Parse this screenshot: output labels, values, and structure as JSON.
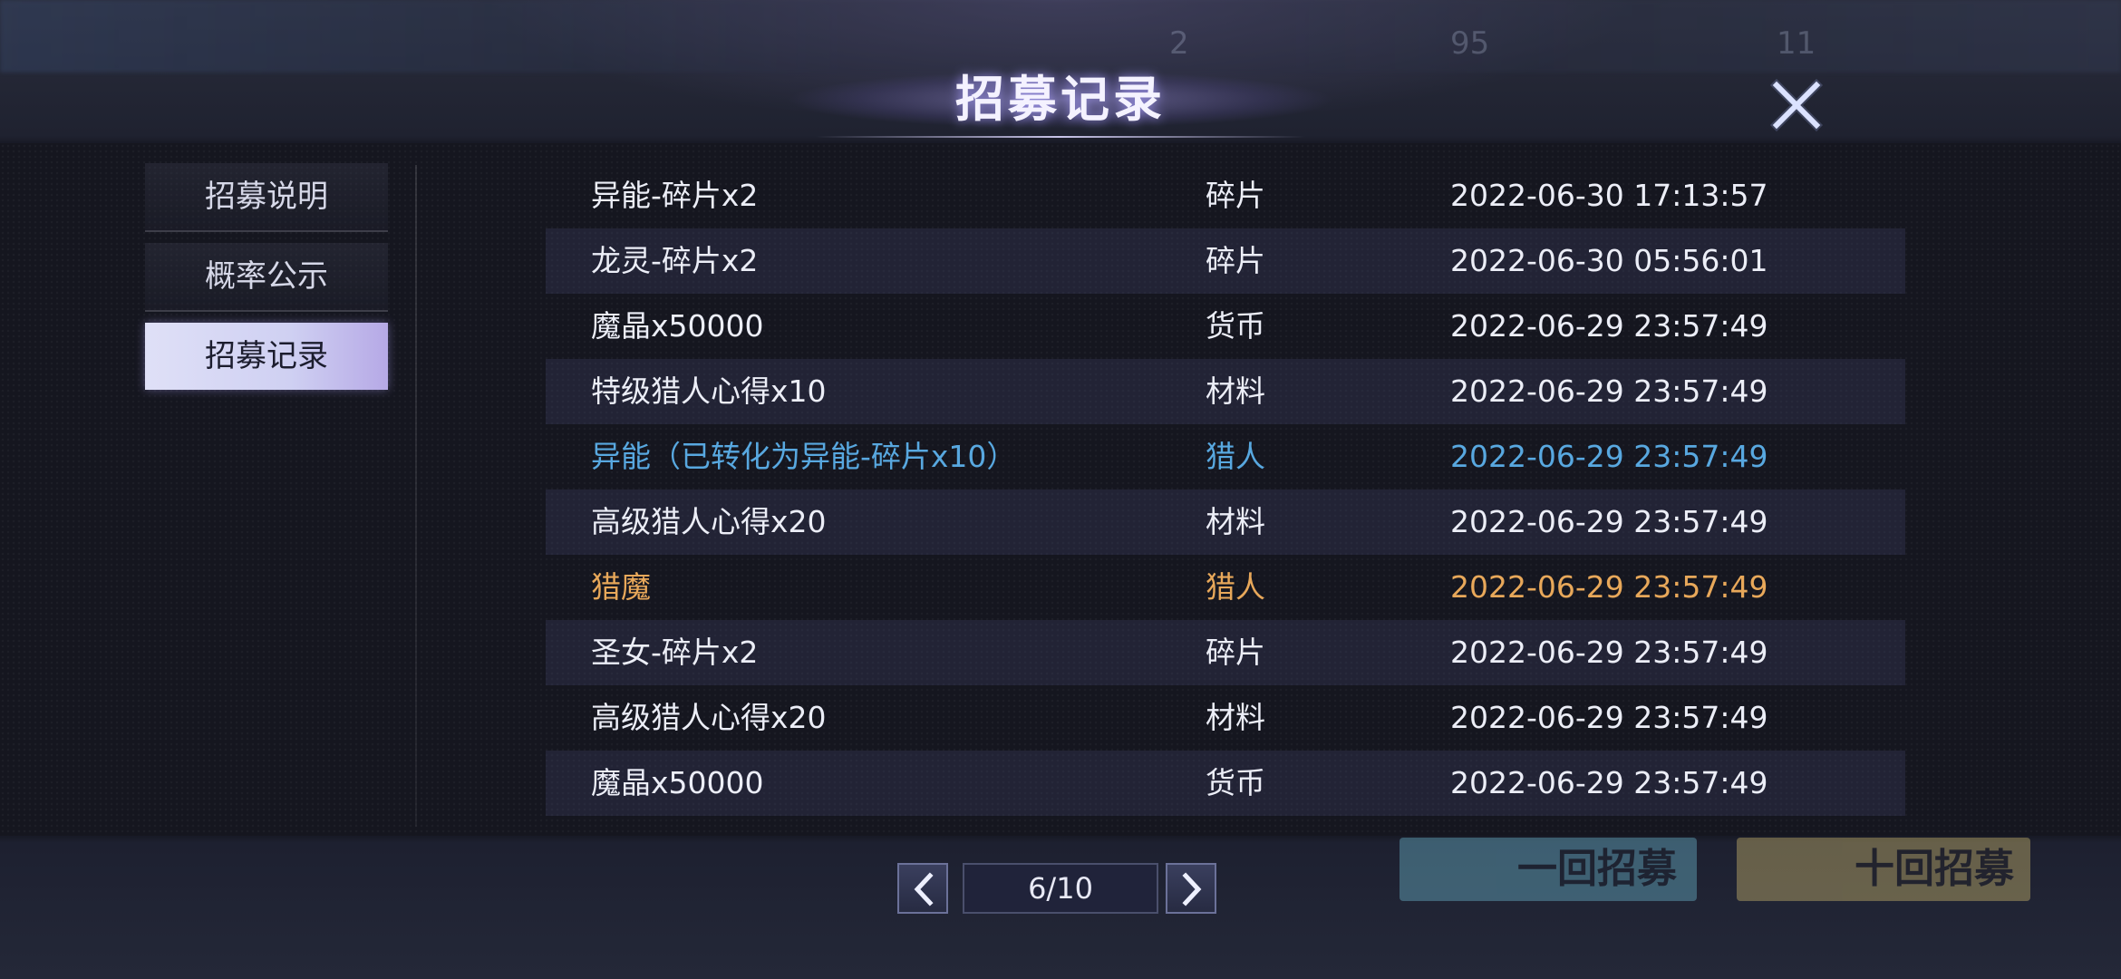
{
  "header": {
    "title": "招募记录"
  },
  "background": {
    "top_items": [
      "2",
      "95",
      "11"
    ],
    "buttons": [
      "一回招募",
      "十回招募"
    ]
  },
  "sidebar": {
    "items": [
      {
        "label": "招募说明",
        "active": false
      },
      {
        "label": "概率公示",
        "active": false
      },
      {
        "label": "招募记录",
        "active": true
      }
    ]
  },
  "records": [
    {
      "name": "异能-碎片x2",
      "type": "碎片",
      "time": "2022-06-30 17:13:57",
      "color": "#eceef7"
    },
    {
      "name": "龙灵-碎片x2",
      "type": "碎片",
      "time": "2022-06-30 05:56:01",
      "color": "#eceef7"
    },
    {
      "name": "魔晶x50000",
      "type": "货币",
      "time": "2022-06-29 23:57:49",
      "color": "#eceef7"
    },
    {
      "name": "特级猎人心得x10",
      "type": "材料",
      "time": "2022-06-29 23:57:49",
      "color": "#eceef7"
    },
    {
      "name": "异能（已转化为异能-碎片x10）",
      "type": "猎人",
      "time": "2022-06-29 23:57:49",
      "color": "#58a8e0"
    },
    {
      "name": "高级猎人心得x20",
      "type": "材料",
      "time": "2022-06-29 23:57:49",
      "color": "#eceef7"
    },
    {
      "name": "猎魔",
      "type": "猎人",
      "time": "2022-06-29 23:57:49",
      "color": "#e8a85a"
    },
    {
      "name": "圣女-碎片x2",
      "type": "碎片",
      "time": "2022-06-29 23:57:49",
      "color": "#eceef7"
    },
    {
      "name": "高级猎人心得x20",
      "type": "材料",
      "time": "2022-06-29 23:57:49",
      "color": "#eceef7"
    },
    {
      "name": "魔晶x50000",
      "type": "货币",
      "time": "2022-06-29 23:57:49",
      "color": "#eceef7"
    }
  ],
  "pager": {
    "current": "6/10"
  },
  "icons": {
    "close": "close-icon",
    "prev": "chevron-left-icon",
    "next": "chevron-right-icon"
  }
}
